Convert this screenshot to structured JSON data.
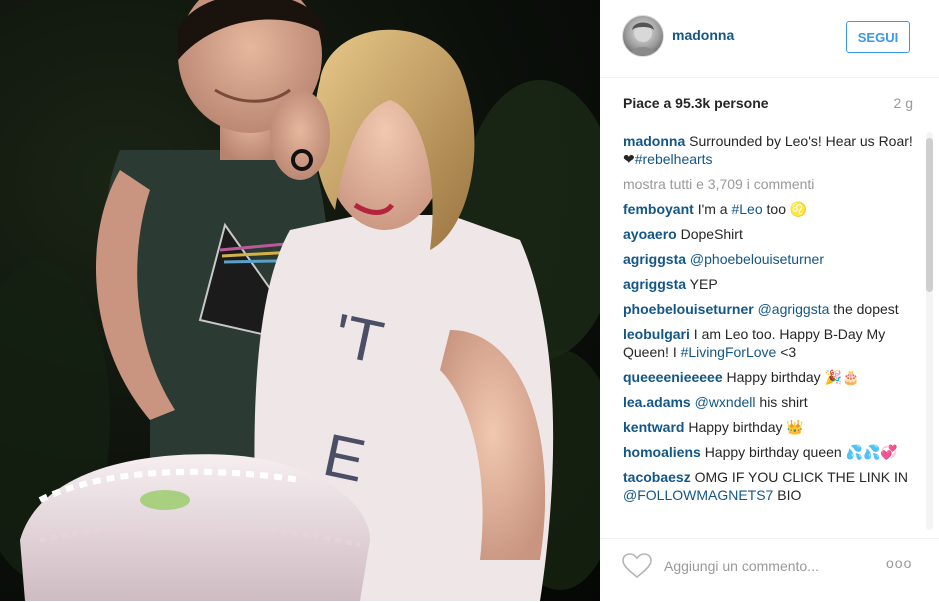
{
  "post": {
    "username": "madonna",
    "follow_label": "SEGUI",
    "likes": "Piace a 95.3k persone",
    "age": "2 g",
    "caption": {
      "user": "madonna",
      "text": "Surrounded by Leo's! Hear us Roar! ❤",
      "hashtag": "#rebelhearts"
    },
    "load_more": "mostra tutti e 3,709 i commenti",
    "comments": [
      {
        "user": "femboyant",
        "pre": "I'm a ",
        "tag": "#Leo",
        "post": " too ♌"
      },
      {
        "user": "ayoaero",
        "pre": "DopeShirt",
        "tag": "",
        "post": ""
      },
      {
        "user": "agriggsta",
        "pre": "",
        "tag": "@phoebelouiseturner",
        "post": ""
      },
      {
        "user": "agriggsta",
        "pre": "YEP",
        "tag": "",
        "post": ""
      },
      {
        "user": "phoebelouiseturner",
        "pre": "",
        "tag": "@agriggsta",
        "post": " the dopest"
      },
      {
        "user": "leobulgari",
        "pre": "I am Leo too. Happy B-Day My Queen! I ",
        "tag": "#LivingForLove",
        "post": " <3"
      },
      {
        "user": "queeeenieeeee",
        "pre": "Happy birthday 🎉🎂",
        "tag": "",
        "post": ""
      },
      {
        "user": "lea.adams",
        "pre": "",
        "tag": "@wxndell",
        "post": " his shirt"
      },
      {
        "user": "kentward",
        "pre": "Happy birthday 👑",
        "tag": "",
        "post": ""
      },
      {
        "user": "homoaliens",
        "pre": "Happy birthday queen 💦💦💞",
        "tag": "",
        "post": ""
      },
      {
        "user": "tacobaesz",
        "pre": "OMG IF YOU CLICK THE LINK IN ",
        "tag": "@FOLLOWMAGNETS7",
        "post": " BIO"
      }
    ],
    "add_comment_placeholder": "Aggiungi un commento...",
    "more_label": "ooo"
  },
  "colors": {
    "link": "#125688",
    "follow_blue": "#3897f0",
    "muted": "#999999",
    "text": "#262626"
  },
  "icons": {
    "like": "heart-outline-icon",
    "more": "more-options-icon"
  }
}
